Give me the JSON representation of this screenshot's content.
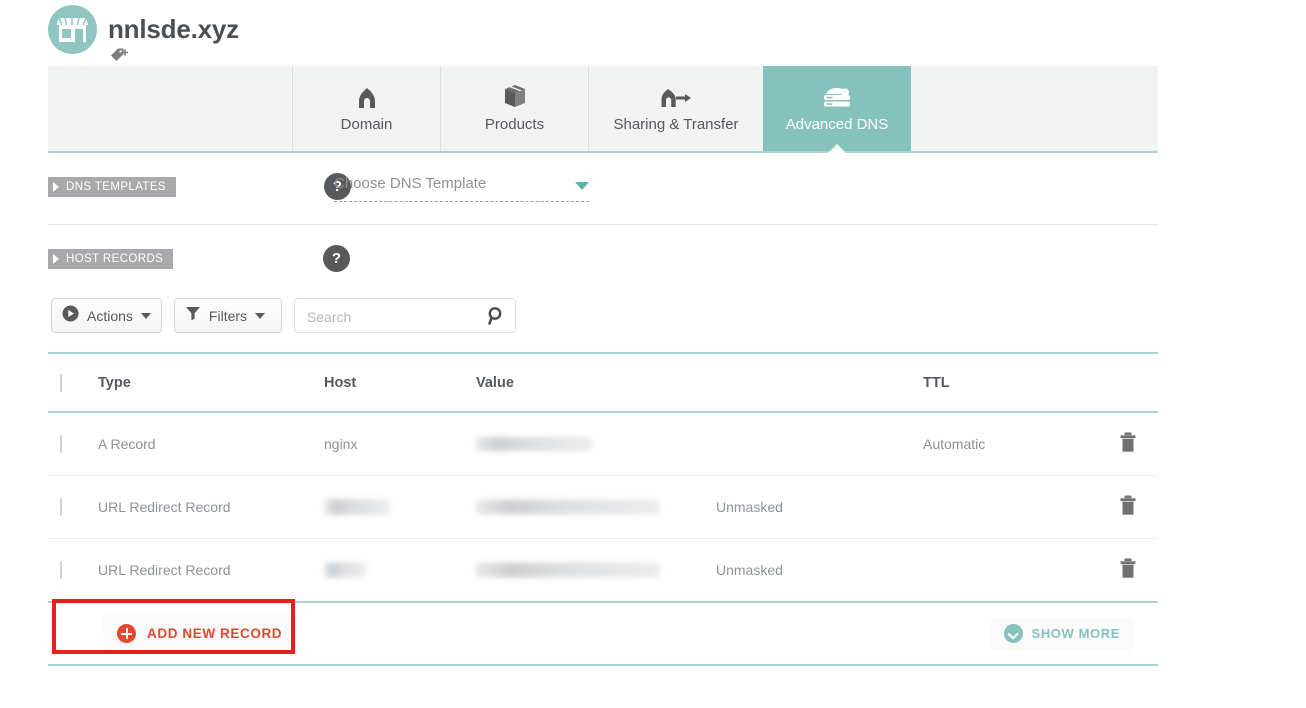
{
  "header": {
    "domain_title": "nnlsde.xyz",
    "avatar_icon": "storefront-icon",
    "tag_icon": "tag-add-icon",
    "avatar_color": "#8fc6c2"
  },
  "tabs": [
    {
      "label": "Domain",
      "icon": "home-icon",
      "active": false
    },
    {
      "label": "Products",
      "icon": "box-icon",
      "active": false
    },
    {
      "label": "Sharing & Transfer",
      "icon": "transfer-icon",
      "active": false
    },
    {
      "label": "Advanced DNS",
      "icon": "server-icon",
      "active": true
    }
  ],
  "accent_teal": "#86c2bd",
  "sections": {
    "dns_templates": {
      "flag_label": "DNS TEMPLATES",
      "help_label": "?",
      "select_placeholder": "Choose DNS Template",
      "caret_icon": "chevron-down-icon"
    },
    "host_records": {
      "flag_label": "HOST RECORDS",
      "help_label": "?"
    }
  },
  "toolbar": {
    "actions_label": "Actions",
    "actions_icon": "play-circle-icon",
    "filters_label": "Filters",
    "filters_icon": "funnel-icon",
    "search_placeholder": "Search",
    "search_value": "",
    "search_icon": "search-icon"
  },
  "table": {
    "columns": [
      "Type",
      "Host",
      "Value",
      "TTL"
    ],
    "rows": [
      {
        "type": "A Record",
        "host": "nginx",
        "host_redacted": false,
        "value": "",
        "value_redacted": true,
        "mask": "",
        "ttl": "Automatic",
        "delete_icon": "trash-icon"
      },
      {
        "type": "URL Redirect Record",
        "host": "",
        "host_redacted": true,
        "value": "",
        "value_redacted": true,
        "mask": "Unmasked",
        "ttl": "",
        "delete_icon": "trash-icon"
      },
      {
        "type": "URL Redirect Record",
        "host": "",
        "host_redacted": true,
        "value": "",
        "value_redacted": true,
        "mask": "Unmasked",
        "ttl": "",
        "delete_icon": "trash-icon"
      }
    ]
  },
  "footer": {
    "add_record_label": "ADD NEW RECORD",
    "add_record_icon": "plus-circle-icon",
    "add_record_color": "#e0492f",
    "show_more_label": "SHOW MORE",
    "show_more_icon": "chevron-down-circle-icon",
    "show_more_color": "#86c2bd"
  },
  "annotation": {
    "highlight_color": "#e0231f",
    "highlight_target": "add-new-record-button"
  }
}
